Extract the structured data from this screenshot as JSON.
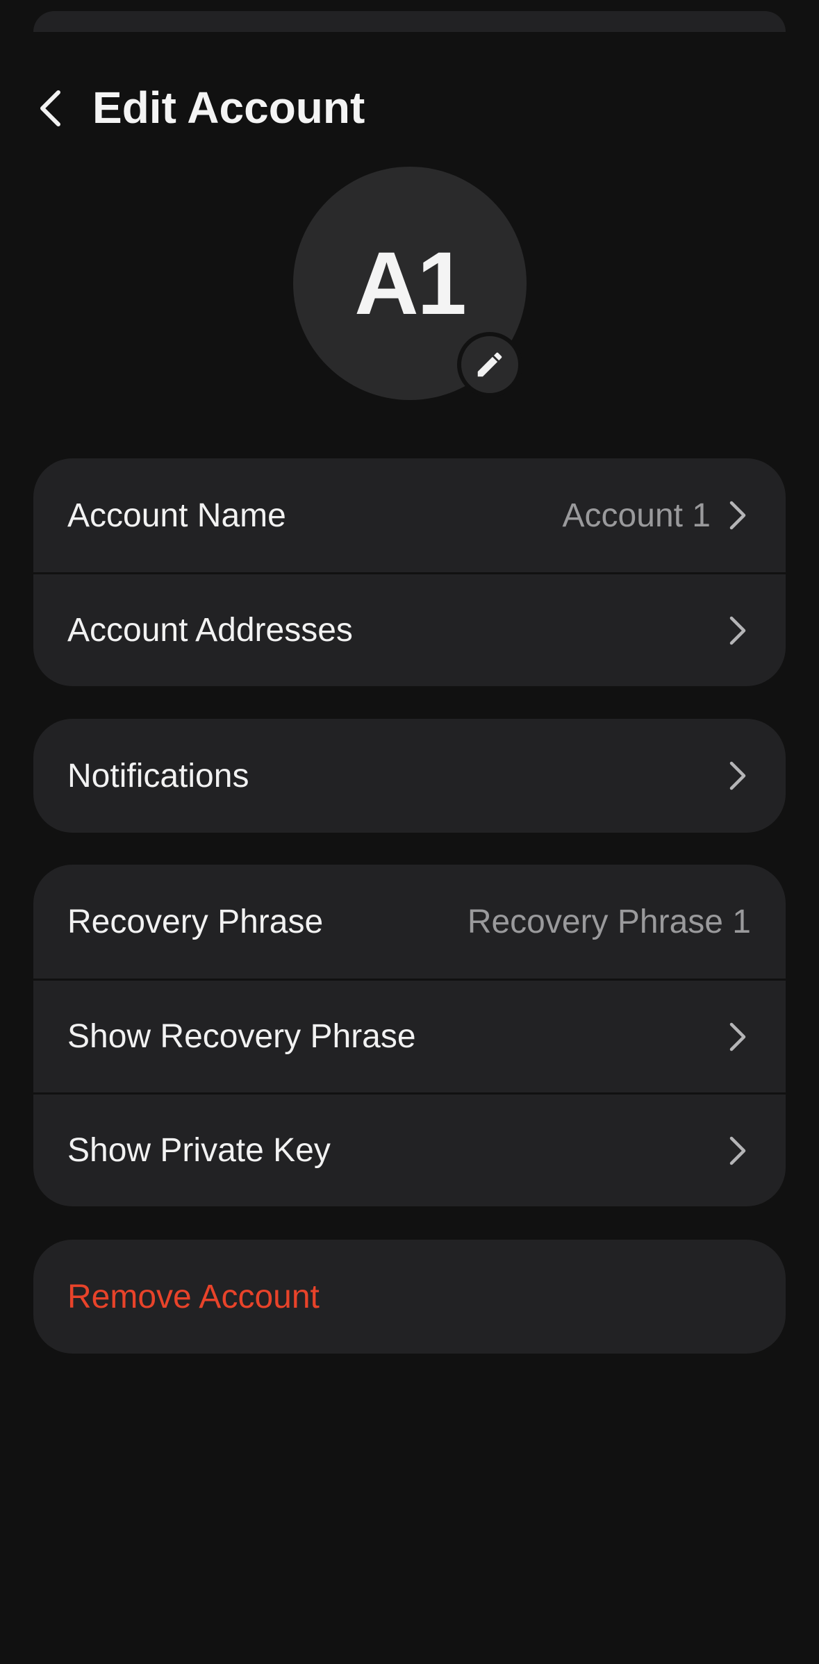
{
  "header": {
    "title": "Edit Account",
    "back_icon": "chevron-left-icon"
  },
  "avatar": {
    "initials": "A1",
    "edit_icon": "pencil-icon"
  },
  "groups": {
    "account": {
      "name_label": "Account Name",
      "name_value": "Account 1",
      "addresses_label": "Account Addresses"
    },
    "notifications": {
      "label": "Notifications"
    },
    "security": {
      "recovery_label": "Recovery Phrase",
      "recovery_value": "Recovery Phrase 1",
      "show_recovery_label": "Show Recovery Phrase",
      "show_private_key_label": "Show Private Key"
    },
    "danger": {
      "remove_label": "Remove Account"
    }
  },
  "colors": {
    "background": "#111111",
    "card": "#222224",
    "text": "#f2f2f2",
    "secondary_text": "#9a9a9c",
    "danger": "#e8432a"
  }
}
